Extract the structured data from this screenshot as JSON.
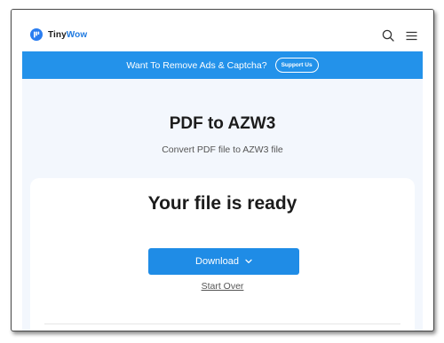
{
  "header": {
    "logo_prefix": "Tiny",
    "logo_suffix": "Wow",
    "icons": [
      "search-icon",
      "hamburger-menu-icon"
    ]
  },
  "banner": {
    "text": "Want To Remove Ads & Captcha?",
    "button_label": "Support Us"
  },
  "main": {
    "title": "PDF to AZW3",
    "subtitle": "Convert PDF file to AZW3 file",
    "status": "Your file is ready",
    "download_label": "Download",
    "start_over_label": "Start Over"
  },
  "colors": {
    "brand_blue": "#2392ea",
    "button_blue": "#1f8ce6",
    "content_bg": "#f3f7fd"
  }
}
